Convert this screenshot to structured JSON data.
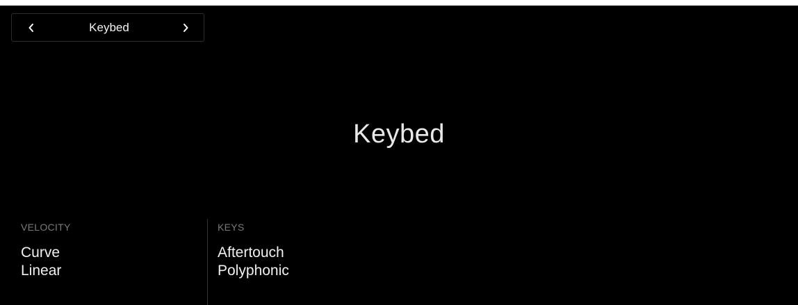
{
  "nav": {
    "title": "Keybed",
    "prev_icon": "chevron-left-icon",
    "next_icon": "chevron-right-icon"
  },
  "page": {
    "title": "Keybed"
  },
  "groups": [
    {
      "header": "VELOCITY",
      "param_name": "Curve",
      "param_value": "Linear"
    },
    {
      "header": "KEYS",
      "param_name": "Aftertouch",
      "param_value": "Polyphonic"
    }
  ],
  "colors": {
    "background": "#000000",
    "text": "#f0f0f0",
    "header": "#7a7a7a",
    "border": "#2c2c2c"
  }
}
